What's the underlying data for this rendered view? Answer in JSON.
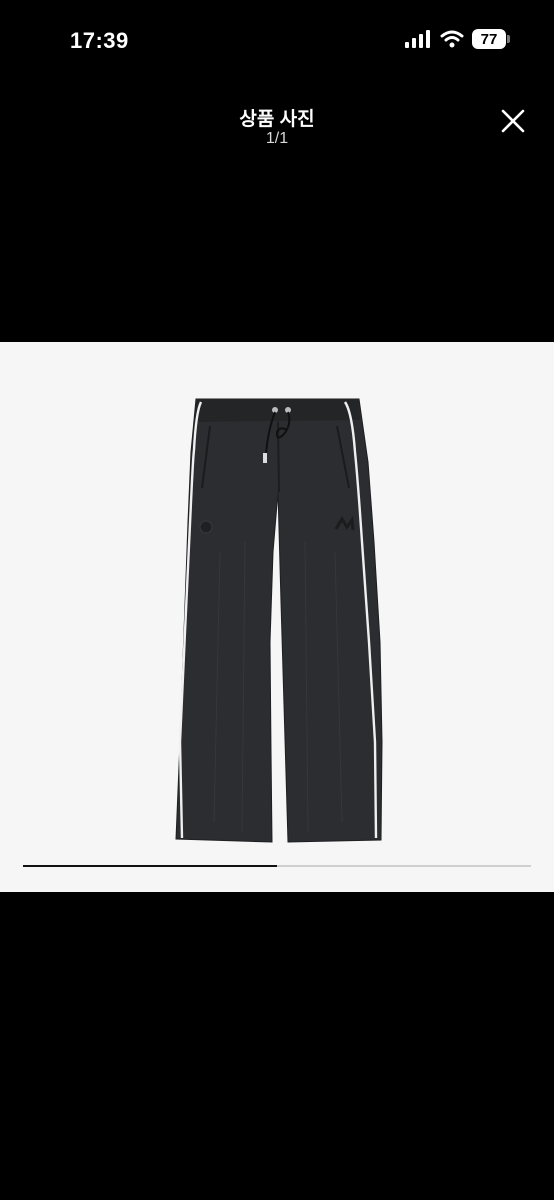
{
  "status_bar": {
    "time": "17:39",
    "battery": "77",
    "icons": [
      "cellular-signal-icon",
      "wifi-icon",
      "battery-icon"
    ]
  },
  "header": {
    "title": "상품 사진",
    "counter": "1/1",
    "close_icon": "close-icon"
  },
  "image": {
    "description": "black track pants",
    "background": "#f6f6f6"
  },
  "scroll": {
    "progress": 0.5
  },
  "colors": {
    "background": "#000000",
    "text": "#ffffff",
    "photo_background": "#f6f6f6"
  }
}
